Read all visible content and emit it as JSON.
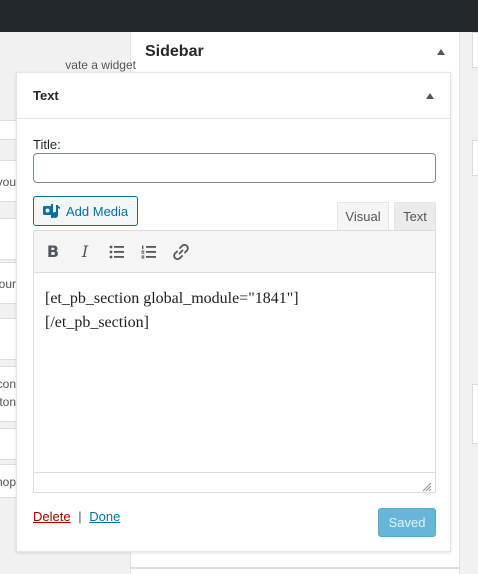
{
  "behind": {
    "hint_text": "vate a widget",
    "left_fragments": [
      "you",
      "our",
      "con",
      "ton",
      "hop"
    ]
  },
  "sidebar": {
    "title": "Sidebar"
  },
  "widget": {
    "title": "Text",
    "title_field_label": "Title:",
    "title_field_value": "",
    "add_media_label": "Add Media",
    "tabs": [
      {
        "label": "Visual",
        "active": false
      },
      {
        "label": "Text",
        "active": true
      }
    ],
    "toolbar": [
      "bold-icon",
      "italic-icon",
      "bulleted-list-icon",
      "numbered-list-icon",
      "link-icon"
    ],
    "content_line1": "[et_pb_section global_module=\"1841\"]",
    "content_line2": "[/et_pb_section]",
    "delete_label": "Delete",
    "separator": "|",
    "done_label": "Done",
    "saved_label": "Saved"
  },
  "colors": {
    "admin_bar": "#23282d",
    "link_blue": "#0073aa",
    "delete_red": "#a00",
    "saved_button": "#66b6d9"
  }
}
